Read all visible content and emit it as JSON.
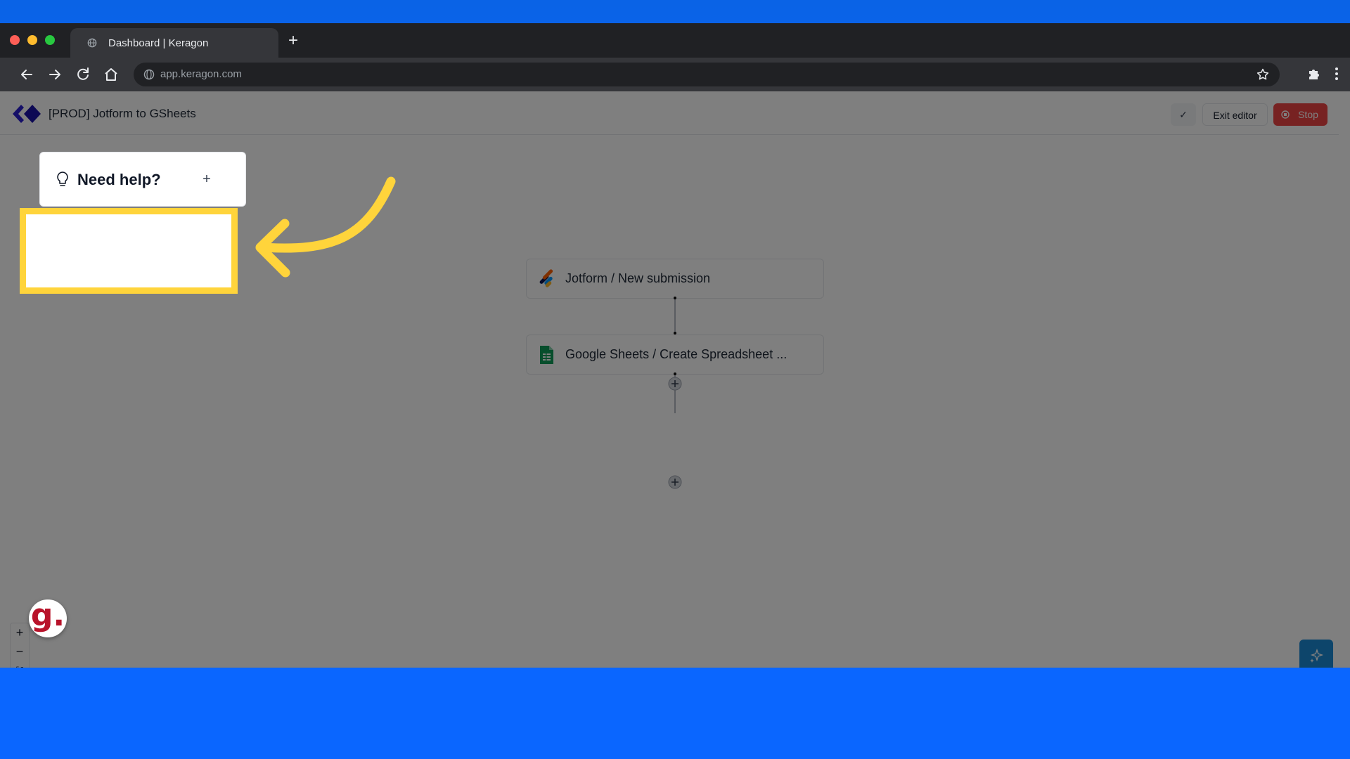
{
  "browser": {
    "tab_title": "Dashboard | Keragon",
    "new_tab_symbol": "+",
    "url": "app.keragon.com"
  },
  "app": {
    "flow_title": "[PROD] Jotform to GSheets",
    "header": {
      "check_symbol": "✓",
      "exit_label": "Exit editor",
      "stop_label": "Stop"
    },
    "help": {
      "title": "Need help?",
      "expand_symbol": "+"
    },
    "nodes": [
      {
        "label": "Jotform / New submission",
        "icon": "jotform-icon"
      },
      {
        "label": "Google Sheets / Create Spreadsheet ...",
        "icon": "google-sheets-icon"
      }
    ],
    "zoom": {
      "in_symbol": "+",
      "out_symbol": "−",
      "fit_symbol": "⛶"
    },
    "avatar_letter": "g."
  },
  "colors": {
    "highlight": "#ffd43b",
    "stop_button": "#ef4444",
    "ai_button": "#1b8bd6",
    "background": "#0a66ff"
  }
}
